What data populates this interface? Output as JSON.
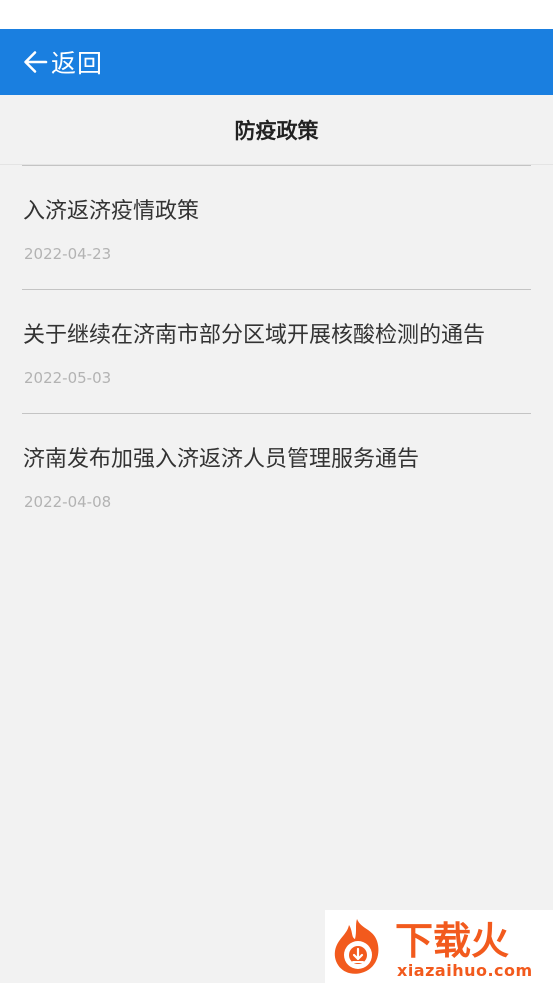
{
  "header": {
    "back_label": "返回"
  },
  "page": {
    "title": "防疫政策"
  },
  "items": [
    {
      "title": "入济返济疫情政策",
      "date": "2022-04-23"
    },
    {
      "title": "关于继续在济南市部分区域开展核酸检测的通告",
      "date": "2022-05-03"
    },
    {
      "title": "济南发布加强入济返济人员管理服务通告",
      "date": "2022-04-08"
    }
  ],
  "watermark": {
    "brand": "下载火",
    "site": "xiazaihuo.com"
  },
  "colors": {
    "header_bg": "#1a7fe0",
    "page_bg": "#f2f2f2",
    "watermark_orange": "#f25a1d"
  }
}
